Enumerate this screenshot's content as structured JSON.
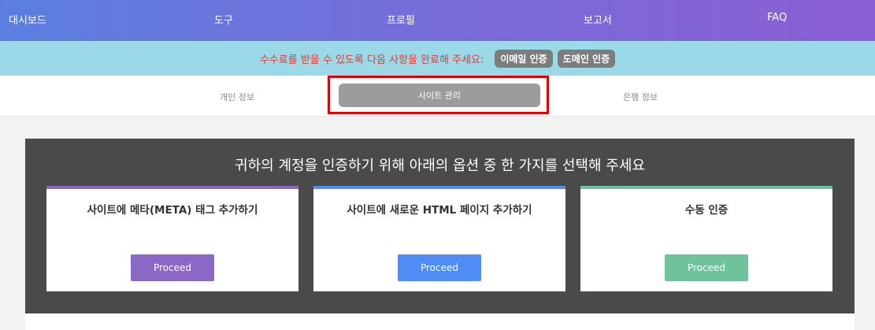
{
  "nav": {
    "items": [
      "대시보드",
      "도구",
      "프로필",
      "보고서",
      "FAQ"
    ]
  },
  "alert": {
    "text": "수수료를 받을 수 있도록 다음 사항을 완료해 주세요:",
    "email_badge": "이메일 인증",
    "domain_badge": "도메인 인증"
  },
  "tabs": {
    "personal": "개인 정보",
    "site": "사이트 관리",
    "bank": "은행 정보"
  },
  "panel": {
    "title": "귀하의 계정을 인증하기 위해 아래의 옵션 중 한 가지를 선택해 주세요",
    "cards": [
      {
        "title": "사이트에 메타(META) 태그 추가하기",
        "button": "Proceed",
        "color": "#8b67c8"
      },
      {
        "title": "사이트에 새로운 HTML 페이지 추가하기",
        "button": "Proceed",
        "color": "#4f8cf6"
      },
      {
        "title": "수동 인증",
        "button": "Proceed",
        "color": "#6fc29b"
      }
    ]
  },
  "colors": {
    "nav_gradient_start": "#5b7fe0",
    "nav_gradient_end": "#8a5fd3",
    "alert_bg": "#9bd9e8",
    "alert_text": "#e53b2c",
    "highlight": "#e00000"
  }
}
